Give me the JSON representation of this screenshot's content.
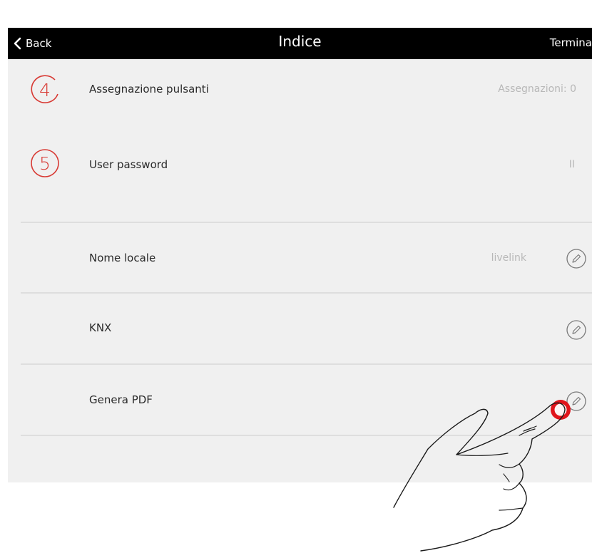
{
  "navbar": {
    "back_label": "Back",
    "title": "Indice",
    "done_label": "Termina"
  },
  "steps": [
    {
      "number": "4",
      "label": "Assegnazione pulsanti",
      "value": "Assegnazioni: 0"
    },
    {
      "number": "5",
      "label": "User password",
      "value": "II"
    }
  ],
  "settings": [
    {
      "label": "Nome locale",
      "value": "livelink",
      "icon": "pencil-icon"
    },
    {
      "label": "KNX",
      "value": "",
      "icon": "pencil-icon"
    },
    {
      "label": "Genera PDF",
      "value": "",
      "icon": "pencil-icon"
    }
  ],
  "colors": {
    "accent": "#d83a34",
    "navbar_bg": "#000000",
    "screen_bg": "#f0f0f0",
    "value_text": "#b8b8b8"
  }
}
